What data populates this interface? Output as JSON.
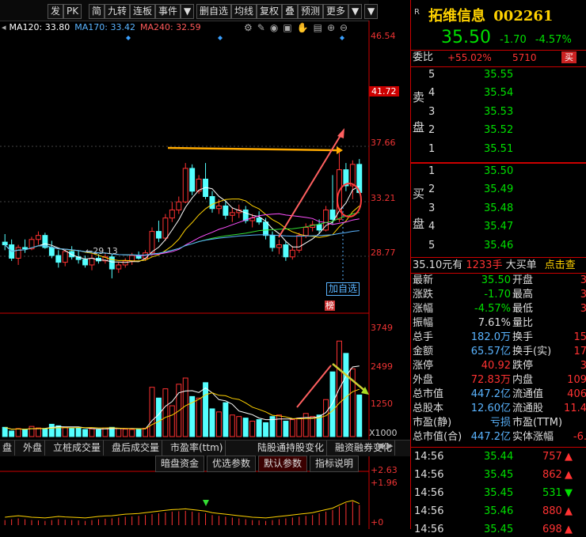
{
  "toolbar": {
    "buttons": [
      "发",
      "PK",
      "简",
      "九转",
      "连板",
      "事件",
      "▼",
      "删自选",
      "均线",
      "复权",
      "叠",
      "预测",
      "更多",
      "▼",
      "▼"
    ]
  },
  "legend": [
    {
      "label": "MA120: 33.80",
      "color": "#ffffff"
    },
    {
      "label": "MA170: 33.42",
      "color": "#5ab4ff"
    },
    {
      "label": "MA240: 32.59",
      "color": "#ff5a5a"
    }
  ],
  "price_axis": [
    "46.54",
    "41.72",
    "37.66",
    "33.21",
    "28.77"
  ],
  "price_axis_hl": "41.72",
  "low_marker": "29.13",
  "add_watch_label": "加自选",
  "rank_badge": "榜",
  "vol_axis": [
    "3749",
    "2499",
    "1250",
    "X1000"
  ],
  "macd_axis": [
    "+2.63",
    "+1.96",
    "+0"
  ],
  "bottom_tabs": [
    "盘",
    "外盘",
    "立桩成交量",
    "盘后成交量",
    "市盈率(ttm)",
    "陆股通持股变化",
    "融资融券变化"
  ],
  "sub_tabs": [
    "暗盘资金",
    "优选参数",
    "默认参数",
    "指标说明"
  ],
  "chart_data": {
    "type": "candlestick",
    "price_ylim": [
      26.5,
      47.5
    ],
    "candles": [
      [
        31.8,
        32.4,
        31.2,
        31.6
      ],
      [
        31.6,
        32.0,
        30.4,
        30.6
      ],
      [
        30.6,
        31.6,
        30.1,
        31.4
      ],
      [
        31.4,
        32.0,
        31.0,
        31.3
      ],
      [
        31.3,
        32.2,
        31.2,
        32.0
      ],
      [
        32.0,
        32.6,
        31.6,
        32.3
      ],
      [
        32.3,
        32.5,
        31.3,
        31.4
      ],
      [
        31.4,
        31.9,
        30.6,
        30.8
      ],
      [
        30.8,
        31.2,
        29.9,
        30.3
      ],
      [
        30.3,
        31.3,
        30.0,
        31.1
      ],
      [
        31.1,
        31.5,
        30.5,
        30.7
      ],
      [
        30.7,
        31.2,
        30.2,
        30.5
      ],
      [
        30.5,
        30.8,
        29.9,
        30.1
      ],
      [
        30.1,
        30.9,
        29.7,
        30.6
      ],
      [
        30.6,
        30.9,
        30.2,
        30.4
      ],
      [
        30.4,
        30.9,
        30.2,
        30.7
      ],
      [
        30.7,
        30.9,
        29.1,
        29.8
      ],
      [
        29.8,
        30.3,
        29.5,
        30.1
      ],
      [
        30.1,
        30.6,
        29.9,
        30.4
      ],
      [
        30.4,
        31.0,
        30.1,
        30.8
      ],
      [
        30.8,
        31.1,
        30.5,
        30.6
      ],
      [
        30.6,
        31.2,
        30.4,
        31.0
      ],
      [
        31.0,
        32.9,
        30.8,
        32.6
      ],
      [
        32.6,
        33.4,
        31.8,
        32.1
      ],
      [
        32.1,
        33.9,
        31.9,
        33.6
      ],
      [
        33.6,
        34.8,
        33.3,
        34.2
      ],
      [
        34.2,
        35.2,
        33.9,
        34.8
      ],
      [
        34.8,
        37.7,
        34.7,
        37.3
      ],
      [
        37.3,
        37.6,
        35.3,
        35.6
      ],
      [
        35.6,
        36.8,
        35.4,
        36.5
      ],
      [
        36.5,
        37.7,
        35.0,
        35.2
      ],
      [
        35.2,
        35.6,
        34.0,
        34.3
      ],
      [
        34.3,
        35.0,
        33.9,
        34.5
      ],
      [
        34.5,
        34.9,
        33.5,
        33.8
      ],
      [
        33.8,
        34.4,
        33.3,
        34.0
      ],
      [
        34.0,
        34.6,
        33.6,
        34.2
      ],
      [
        34.2,
        34.5,
        33.2,
        33.4
      ],
      [
        33.4,
        33.9,
        32.9,
        33.6
      ],
      [
        33.6,
        34.1,
        33.1,
        33.3
      ],
      [
        33.3,
        33.6,
        32.0,
        32.3
      ],
      [
        32.3,
        32.6,
        31.1,
        31.4
      ],
      [
        31.4,
        32.0,
        30.9,
        31.6
      ],
      [
        31.6,
        31.9,
        30.4,
        30.7
      ],
      [
        30.7,
        31.5,
        30.5,
        31.2
      ],
      [
        31.2,
        32.5,
        31.0,
        32.3
      ],
      [
        32.3,
        33.2,
        32.1,
        32.9
      ],
      [
        32.9,
        33.4,
        32.6,
        33.1
      ],
      [
        33.1,
        33.5,
        32.4,
        32.7
      ],
      [
        32.7,
        34.5,
        32.6,
        34.2
      ],
      [
        34.2,
        36.8,
        33.1,
        33.5
      ],
      [
        33.5,
        38.5,
        33.3,
        37.2
      ],
      [
        37.2,
        37.7,
        35.6,
        36.0
      ],
      [
        36.0,
        37.9,
        35.0,
        37.6
      ],
      [
        37.6,
        38.0,
        35.4,
        35.5
      ]
    ],
    "volume_ylim": [
      0,
      3800
    ],
    "volumes": [
      300,
      180,
      260,
      220,
      330,
      280,
      250,
      400,
      350,
      300,
      260,
      270,
      230,
      250,
      220,
      280,
      300,
      260,
      240,
      230,
      250,
      270,
      1600,
      1250,
      1550,
      1000,
      1700,
      1900,
      1300,
      1250,
      1750,
      900,
      800,
      1100,
      700,
      650,
      600,
      500,
      550,
      450,
      650,
      700,
      500,
      550,
      600,
      750,
      650,
      700,
      1200,
      2100,
      3100,
      2700,
      2200,
      1350
    ],
    "volume_up": [
      0,
      0,
      1,
      0,
      1,
      1,
      0,
      0,
      0,
      1,
      0,
      0,
      0,
      1,
      0,
      1,
      0,
      1,
      1,
      1,
      0,
      1,
      1,
      0,
      1,
      1,
      1,
      1,
      0,
      1,
      0,
      0,
      1,
      0,
      1,
      1,
      0,
      1,
      0,
      0,
      0,
      1,
      0,
      1,
      1,
      1,
      1,
      0,
      1,
      0,
      1,
      0,
      1,
      0
    ],
    "macd_ylim": [
      0,
      3.0
    ],
    "macd": [
      0.3,
      0.35,
      0.4,
      0.35,
      0.3,
      0.28,
      0.25,
      0.3,
      0.35,
      0.32,
      0.3,
      0.28,
      0.25,
      0.3,
      0.35,
      0.38,
      0.4,
      0.45,
      0.5,
      0.52,
      0.55,
      0.6,
      0.65,
      0.7,
      0.75,
      0.8,
      0.82,
      0.85,
      0.8,
      0.75,
      0.7,
      0.6,
      0.55,
      0.5,
      0.45,
      0.4,
      0.35,
      0.3,
      0.28,
      0.25,
      0.3,
      0.35,
      0.4,
      0.45,
      0.5,
      0.55,
      0.6,
      0.7,
      0.8,
      0.9,
      1.1,
      1.3,
      1.4,
      1.2
    ]
  },
  "stock": {
    "name": "拓维信息",
    "code": "002261",
    "price": "35.50",
    "change": "-1.70",
    "pct": "-4.57%",
    "r_icon": "R"
  },
  "weibi": {
    "label": "委比",
    "pct": "+55.02%",
    "diff": "5710",
    "tag": "买"
  },
  "sell": {
    "side": [
      "卖",
      "盘"
    ],
    "levels": [
      [
        "5",
        "35.55"
      ],
      [
        "4",
        "35.54"
      ],
      [
        "3",
        "35.53"
      ],
      [
        "2",
        "35.52"
      ],
      [
        "1",
        "35.51"
      ]
    ]
  },
  "buy": {
    "side": [
      "买",
      "盘"
    ],
    "levels": [
      [
        "1",
        "35.50"
      ],
      [
        "2",
        "35.49"
      ],
      [
        "3",
        "35.48"
      ],
      [
        "4",
        "35.47"
      ],
      [
        "5",
        "35.46"
      ]
    ]
  },
  "big_order": {
    "price": "35.10元有",
    "qty": "1233手",
    "label": "大买单",
    "more": "点击查"
  },
  "stats": [
    [
      "最新",
      "35.50",
      "开盘",
      "3"
    ],
    [
      "涨跌",
      "-1.70",
      "最高",
      "3"
    ],
    [
      "涨幅",
      "-4.57%",
      "最低",
      "3"
    ],
    [
      "振幅",
      "7.61%",
      "量比",
      ""
    ],
    [
      "总手",
      "182.0万",
      "换手",
      "15"
    ],
    [
      "金额",
      "65.57亿",
      "换手(实)",
      "17"
    ],
    [
      "涨停",
      "40.92",
      "跌停",
      "3"
    ],
    [
      "外盘",
      "72.83万",
      "内盘",
      "109"
    ],
    [
      "总市值",
      "447.2亿",
      "流通值",
      "406"
    ],
    [
      "总股本",
      "12.60亿",
      "流通股",
      "11.4"
    ],
    [
      "市盈(静)",
      "亏损",
      "市盈(TTM)",
      ""
    ],
    [
      "总市值(合)",
      "447.2亿",
      "实体涨幅",
      "-6."
    ]
  ],
  "ticks": [
    [
      "14:56",
      "35.44",
      "757",
      "up"
    ],
    [
      "14:56",
      "35.45",
      "862",
      "up"
    ],
    [
      "14:56",
      "35.45",
      "531",
      "down"
    ],
    [
      "14:56",
      "35.46",
      "880",
      "up"
    ],
    [
      "14:56",
      "35.45",
      "698",
      "up"
    ]
  ]
}
